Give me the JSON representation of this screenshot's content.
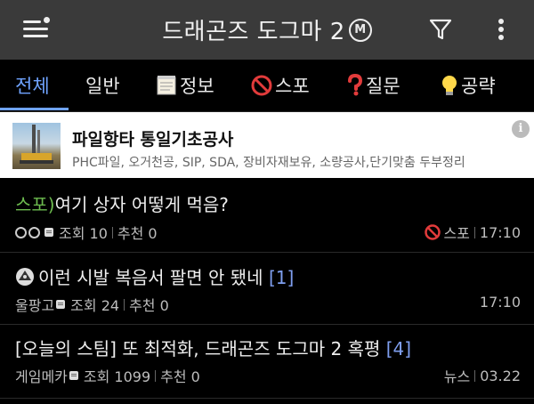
{
  "header": {
    "title": "드래곤즈 도그마 2",
    "badge": "M",
    "icons": {
      "menu": "menu-icon",
      "filter": "filter-icon",
      "more": "more-vert-icon"
    }
  },
  "tabs": [
    {
      "label": "전체",
      "icon": "",
      "active": true
    },
    {
      "label": "일반",
      "icon": ""
    },
    {
      "label": "정보",
      "icon": "document-icon"
    },
    {
      "label": "스포",
      "icon": "prohibited-icon"
    },
    {
      "label": "질문",
      "icon": "question-icon"
    },
    {
      "label": "공략",
      "icon": "lightbulb-icon"
    }
  ],
  "ad": {
    "title": "파일항타 통일기초공사",
    "description": "PHC파일, 오거천공, SIP, SDA, 장비자재보유, 소량공사,단기맞춤 두부정리",
    "info_icon": "info-icon",
    "info_glyph": "i"
  },
  "posts": [
    {
      "prefix": "스포)",
      "title": "여기 상자 어떻게 먹음?",
      "comment_count": "",
      "author": "",
      "views": "조회 10",
      "likes": "추천 0",
      "category": "스포",
      "time": "17:10"
    },
    {
      "prefix": "",
      "title": "이런 시발 복음서 팔면 안 됐네",
      "comment_count": "[1]",
      "author": "울팡고",
      "views": "조회 24",
      "likes": "추천 0",
      "category": "",
      "time": "17:10"
    },
    {
      "prefix": "",
      "title": "[오늘의 스팀] 또 최적화, 드래곤즈 도그마 2 혹평",
      "comment_count": "[4]",
      "author": "게임메카",
      "views": "조회 1099",
      "likes": "추천 0",
      "category": "뉴스",
      "time": "03.22"
    }
  ]
}
